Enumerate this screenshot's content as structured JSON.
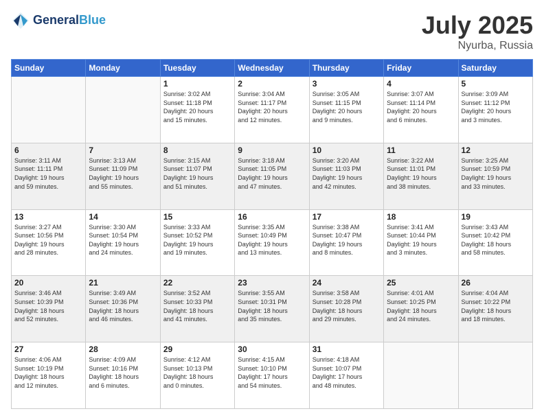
{
  "header": {
    "logo_line1": "General",
    "logo_line2": "Blue",
    "month": "July 2025",
    "location": "Nyurba, Russia"
  },
  "days_of_week": [
    "Sunday",
    "Monday",
    "Tuesday",
    "Wednesday",
    "Thursday",
    "Friday",
    "Saturday"
  ],
  "weeks": [
    [
      {
        "day": "",
        "info": ""
      },
      {
        "day": "",
        "info": ""
      },
      {
        "day": "1",
        "info": "Sunrise: 3:02 AM\nSunset: 11:18 PM\nDaylight: 20 hours\nand 15 minutes."
      },
      {
        "day": "2",
        "info": "Sunrise: 3:04 AM\nSunset: 11:17 PM\nDaylight: 20 hours\nand 12 minutes."
      },
      {
        "day": "3",
        "info": "Sunrise: 3:05 AM\nSunset: 11:15 PM\nDaylight: 20 hours\nand 9 minutes."
      },
      {
        "day": "4",
        "info": "Sunrise: 3:07 AM\nSunset: 11:14 PM\nDaylight: 20 hours\nand 6 minutes."
      },
      {
        "day": "5",
        "info": "Sunrise: 3:09 AM\nSunset: 11:12 PM\nDaylight: 20 hours\nand 3 minutes."
      }
    ],
    [
      {
        "day": "6",
        "info": "Sunrise: 3:11 AM\nSunset: 11:11 PM\nDaylight: 19 hours\nand 59 minutes."
      },
      {
        "day": "7",
        "info": "Sunrise: 3:13 AM\nSunset: 11:09 PM\nDaylight: 19 hours\nand 55 minutes."
      },
      {
        "day": "8",
        "info": "Sunrise: 3:15 AM\nSunset: 11:07 PM\nDaylight: 19 hours\nand 51 minutes."
      },
      {
        "day": "9",
        "info": "Sunrise: 3:18 AM\nSunset: 11:05 PM\nDaylight: 19 hours\nand 47 minutes."
      },
      {
        "day": "10",
        "info": "Sunrise: 3:20 AM\nSunset: 11:03 PM\nDaylight: 19 hours\nand 42 minutes."
      },
      {
        "day": "11",
        "info": "Sunrise: 3:22 AM\nSunset: 11:01 PM\nDaylight: 19 hours\nand 38 minutes."
      },
      {
        "day": "12",
        "info": "Sunrise: 3:25 AM\nSunset: 10:59 PM\nDaylight: 19 hours\nand 33 minutes."
      }
    ],
    [
      {
        "day": "13",
        "info": "Sunrise: 3:27 AM\nSunset: 10:56 PM\nDaylight: 19 hours\nand 28 minutes."
      },
      {
        "day": "14",
        "info": "Sunrise: 3:30 AM\nSunset: 10:54 PM\nDaylight: 19 hours\nand 24 minutes."
      },
      {
        "day": "15",
        "info": "Sunrise: 3:33 AM\nSunset: 10:52 PM\nDaylight: 19 hours\nand 19 minutes."
      },
      {
        "day": "16",
        "info": "Sunrise: 3:35 AM\nSunset: 10:49 PM\nDaylight: 19 hours\nand 13 minutes."
      },
      {
        "day": "17",
        "info": "Sunrise: 3:38 AM\nSunset: 10:47 PM\nDaylight: 19 hours\nand 8 minutes."
      },
      {
        "day": "18",
        "info": "Sunrise: 3:41 AM\nSunset: 10:44 PM\nDaylight: 19 hours\nand 3 minutes."
      },
      {
        "day": "19",
        "info": "Sunrise: 3:43 AM\nSunset: 10:42 PM\nDaylight: 18 hours\nand 58 minutes."
      }
    ],
    [
      {
        "day": "20",
        "info": "Sunrise: 3:46 AM\nSunset: 10:39 PM\nDaylight: 18 hours\nand 52 minutes."
      },
      {
        "day": "21",
        "info": "Sunrise: 3:49 AM\nSunset: 10:36 PM\nDaylight: 18 hours\nand 46 minutes."
      },
      {
        "day": "22",
        "info": "Sunrise: 3:52 AM\nSunset: 10:33 PM\nDaylight: 18 hours\nand 41 minutes."
      },
      {
        "day": "23",
        "info": "Sunrise: 3:55 AM\nSunset: 10:31 PM\nDaylight: 18 hours\nand 35 minutes."
      },
      {
        "day": "24",
        "info": "Sunrise: 3:58 AM\nSunset: 10:28 PM\nDaylight: 18 hours\nand 29 minutes."
      },
      {
        "day": "25",
        "info": "Sunrise: 4:01 AM\nSunset: 10:25 PM\nDaylight: 18 hours\nand 24 minutes."
      },
      {
        "day": "26",
        "info": "Sunrise: 4:04 AM\nSunset: 10:22 PM\nDaylight: 18 hours\nand 18 minutes."
      }
    ],
    [
      {
        "day": "27",
        "info": "Sunrise: 4:06 AM\nSunset: 10:19 PM\nDaylight: 18 hours\nand 12 minutes."
      },
      {
        "day": "28",
        "info": "Sunrise: 4:09 AM\nSunset: 10:16 PM\nDaylight: 18 hours\nand 6 minutes."
      },
      {
        "day": "29",
        "info": "Sunrise: 4:12 AM\nSunset: 10:13 PM\nDaylight: 18 hours\nand 0 minutes."
      },
      {
        "day": "30",
        "info": "Sunrise: 4:15 AM\nSunset: 10:10 PM\nDaylight: 17 hours\nand 54 minutes."
      },
      {
        "day": "31",
        "info": "Sunrise: 4:18 AM\nSunset: 10:07 PM\nDaylight: 17 hours\nand 48 minutes."
      },
      {
        "day": "",
        "info": ""
      },
      {
        "day": "",
        "info": ""
      }
    ]
  ]
}
